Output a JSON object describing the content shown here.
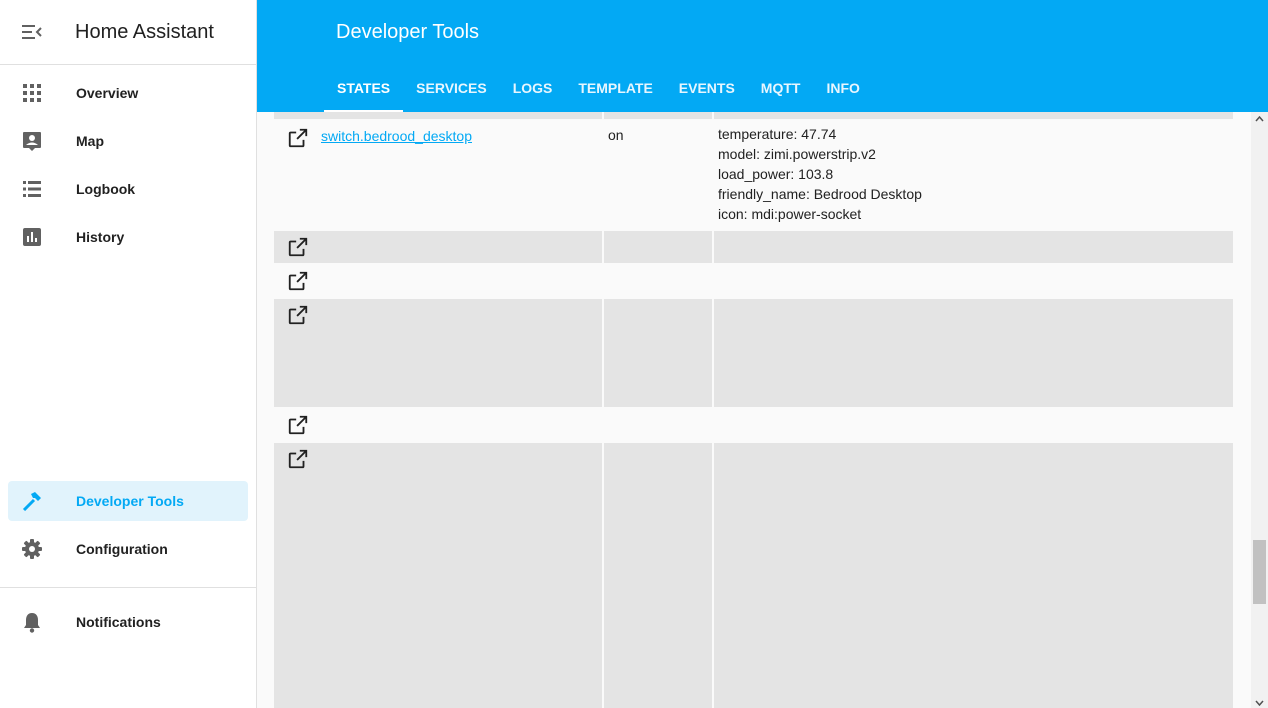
{
  "sidebar": {
    "title": "Home Assistant",
    "items": [
      {
        "label": "Overview",
        "icon": "grid-icon"
      },
      {
        "label": "Map",
        "icon": "map-account-icon"
      },
      {
        "label": "Logbook",
        "icon": "list-icon"
      },
      {
        "label": "History",
        "icon": "chart-box-icon"
      },
      {
        "label": "Developer Tools",
        "icon": "hammer-icon"
      },
      {
        "label": "Configuration",
        "icon": "gear-icon"
      },
      {
        "label": "Notifications",
        "icon": "bell-icon"
      }
    ]
  },
  "header": {
    "title": "Developer Tools",
    "tabs": [
      {
        "label": "STATES"
      },
      {
        "label": "SERVICES"
      },
      {
        "label": "LOGS"
      },
      {
        "label": "TEMPLATE"
      },
      {
        "label": "EVENTS"
      },
      {
        "label": "MQTT"
      },
      {
        "label": "INFO"
      }
    ]
  },
  "table": {
    "rows": [
      {
        "entity": "switch.bedrood_desktop",
        "state": "on",
        "attributes": [
          "temperature: 47.74",
          "model: zimi.powerstrip.v2",
          "load_power: 103.8",
          "friendly_name: Bedrood Desktop",
          "icon: mdi:power-socket"
        ]
      }
    ]
  },
  "colors": {
    "accent": "#03a9f4",
    "header_bg": "#03a9f4",
    "active_item_bg": "#e1f3fc",
    "row_shade": "#e4e4e4"
  }
}
